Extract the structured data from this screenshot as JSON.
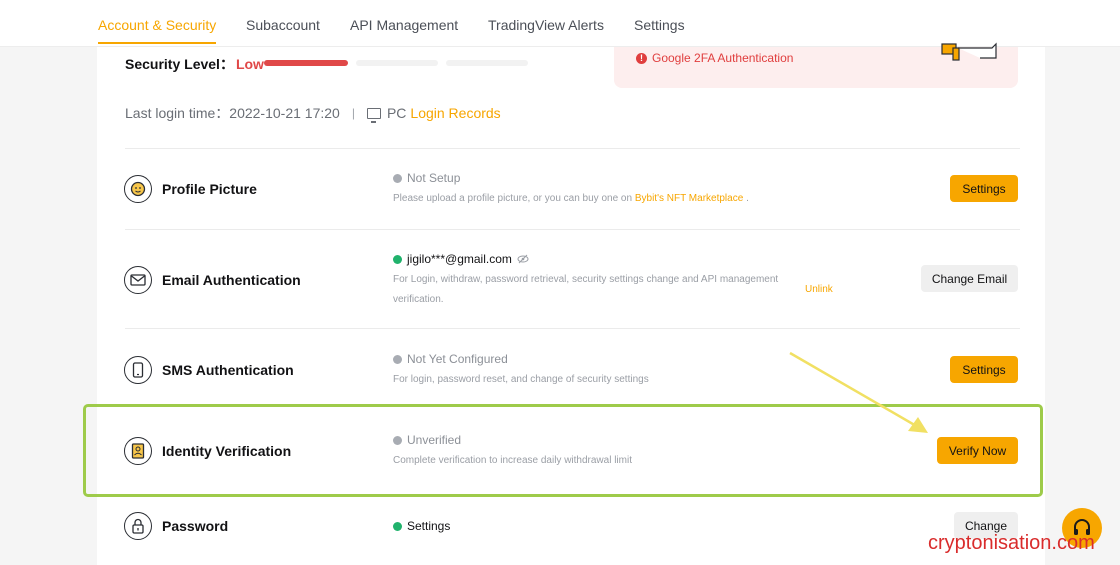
{
  "tabs": [
    "Account & Security",
    "Subaccount",
    "API Management",
    "TradingView Alerts",
    "Settings"
  ],
  "security": {
    "label": "Security Level：",
    "level": "Low",
    "alert_2fa": "Google 2FA Authentication"
  },
  "login": {
    "label": "Last login time：",
    "time": "2022-10-21 17:20",
    "separator": "|",
    "device": "PC",
    "records_link": "Login Records"
  },
  "rows": {
    "profile": {
      "title": "Profile Picture",
      "status": "Not Setup",
      "desc_prefix": "Please upload a profile picture, or you can buy one on",
      "desc_link": "Bybit's NFT Marketplace",
      "desc_suffix": ".",
      "button": "Settings"
    },
    "email": {
      "title": "Email Authentication",
      "status": "jigilo***@gmail.com",
      "desc_line1": "For Login, withdraw, password retrieval, security settings change and API management",
      "desc_line2": "verification.",
      "unlink": "Unlink",
      "button": "Change Email"
    },
    "sms": {
      "title": "SMS Authentication",
      "status": "Not Yet Configured",
      "desc": "For login, password reset, and change of security settings",
      "button": "Settings"
    },
    "identity": {
      "title": "Identity Verification",
      "status": "Unverified",
      "desc": "Complete verification to increase daily withdrawal limit",
      "button": "Verify Now"
    },
    "password": {
      "title": "Password",
      "status": "Settings",
      "button": "Change"
    }
  },
  "watermark": "cryptonisation.com",
  "colors": {
    "accent": "#f7a600",
    "danger": "#e04848",
    "success": "#20b26c",
    "highlight": "#9ecb4a"
  }
}
